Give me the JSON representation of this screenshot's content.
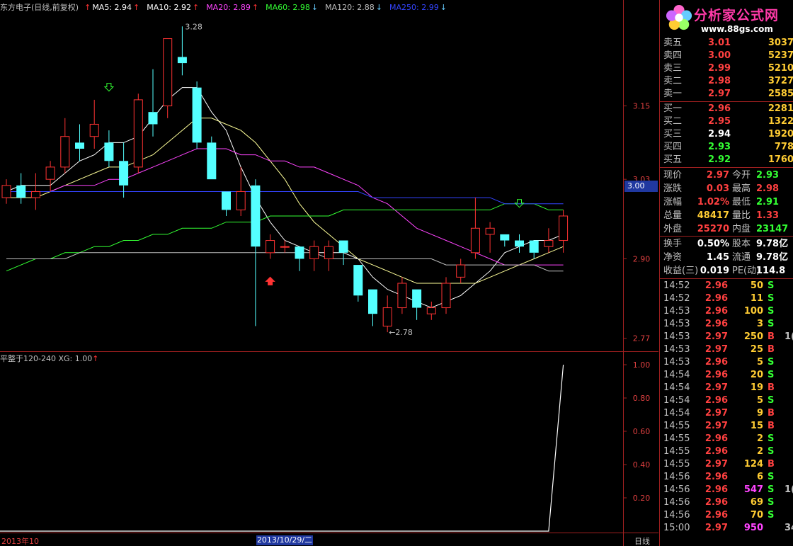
{
  "header": {
    "stock_title": "东方电子(日线,前复权)",
    "ma": [
      {
        "label": "MA5: 2.94",
        "color": "#ffffff",
        "arrow": "↑",
        "dir": "up"
      },
      {
        "label": "MA10: 2.92",
        "color": "#ffffff",
        "arrow": "↑",
        "dir": "up"
      },
      {
        "label": "MA20: 2.89",
        "color": "#ff44ff",
        "arrow": "↑",
        "dir": "up"
      },
      {
        "label": "MA60: 2.98",
        "color": "#33ff33",
        "arrow": "↓",
        "dir": "down"
      },
      {
        "label": "MA120: 2.88",
        "color": "#c0c0c0",
        "arrow": "↓",
        "dir": "down"
      },
      {
        "label": "MA250: 2.99",
        "color": "#3344ff",
        "arrow": "↓",
        "dir": "down"
      }
    ],
    "lead_arrow": "↑"
  },
  "price_axis": [
    "3.15",
    "3.03",
    "2.90",
    "2.77"
  ],
  "price_cursor": "3.00",
  "high_marker": "3.28",
  "low_marker": "←2.78",
  "indicator": {
    "legend": "平整于120-240  XG: 1.00",
    "arrow": "↑",
    "axis": [
      "1.00",
      "0.80",
      "0.60",
      "0.40",
      "0.20"
    ]
  },
  "x_axis": {
    "start": "2013年10",
    "cursor": "2013/10/29/二",
    "period": "日线"
  },
  "logo": {
    "brand": "分析家公式网",
    "url": "www.88gs.com"
  },
  "order_book": {
    "asks": [
      {
        "label": "卖五",
        "price": "3.01",
        "vol": "3037"
      },
      {
        "label": "卖四",
        "price": "3.00",
        "vol": "5237"
      },
      {
        "label": "卖三",
        "price": "2.99",
        "vol": "5210"
      },
      {
        "label": "卖二",
        "price": "2.98",
        "vol": "3727"
      },
      {
        "label": "卖一",
        "price": "2.97",
        "vol": "2585"
      }
    ],
    "bids": [
      {
        "label": "买一",
        "price": "2.96",
        "vol": "2281",
        "cls": "red"
      },
      {
        "label": "买二",
        "price": "2.95",
        "vol": "1322",
        "cls": "red"
      },
      {
        "label": "买三",
        "price": "2.94",
        "vol": "1920",
        "cls": "white"
      },
      {
        "label": "买四",
        "price": "2.93",
        "vol": "778",
        "cls": "green"
      },
      {
        "label": "买五",
        "price": "2.92",
        "vol": "1760",
        "cls": "green"
      }
    ]
  },
  "stats": [
    {
      "k1": "现价",
      "v1": "2.97",
      "c1": "red",
      "k2": "今开",
      "v2": "2.93",
      "c2": "green"
    },
    {
      "k1": "涨跌",
      "v1": "0.03",
      "c1": "red",
      "k2": "最高",
      "v2": "2.98",
      "c2": "red"
    },
    {
      "k1": "涨幅",
      "v1": "1.02%",
      "c1": "red",
      "k2": "最低",
      "v2": "2.91",
      "c2": "green"
    },
    {
      "k1": "总量",
      "v1": "48417",
      "c1": "yellow",
      "k2": "量比",
      "v2": "1.33",
      "c2": "red"
    },
    {
      "k1": "外盘",
      "v1": "25270",
      "c1": "red",
      "k2": "内盘",
      "v2": "23147",
      "c2": "green"
    },
    {
      "k1": "换手",
      "v1": "0.50%",
      "c1": "white",
      "k2": "股本",
      "v2": "9.78亿",
      "c2": "white"
    },
    {
      "k1": "净资",
      "v1": "1.45",
      "c1": "white",
      "k2": "流通",
      "v2": "9.78亿",
      "c2": "white"
    },
    {
      "k1": "收益(三)",
      "v1": "0.019",
      "c1": "white",
      "k2": "PE(动)",
      "v2": "114.8",
      "c2": "white"
    }
  ],
  "ticks": [
    {
      "time": "14:52",
      "price": "2.96",
      "vol": "50",
      "side": "S"
    },
    {
      "time": "14:52",
      "price": "2.96",
      "vol": "11",
      "side": "S"
    },
    {
      "time": "14:53",
      "price": "2.96",
      "vol": "100",
      "side": "S"
    },
    {
      "time": "14:53",
      "price": "2.96",
      "vol": "3",
      "side": "S"
    },
    {
      "time": "14:53",
      "price": "2.97",
      "vol": "250",
      "side": "B",
      "extra": "1("
    },
    {
      "time": "14:53",
      "price": "2.97",
      "vol": "25",
      "side": "B"
    },
    {
      "time": "14:53",
      "price": "2.96",
      "vol": "5",
      "side": "S"
    },
    {
      "time": "14:54",
      "price": "2.96",
      "vol": "20",
      "side": "S"
    },
    {
      "time": "14:54",
      "price": "2.97",
      "vol": "19",
      "side": "B"
    },
    {
      "time": "14:54",
      "price": "2.96",
      "vol": "5",
      "side": "S"
    },
    {
      "time": "14:54",
      "price": "2.97",
      "vol": "9",
      "side": "B"
    },
    {
      "time": "14:55",
      "price": "2.97",
      "vol": "15",
      "side": "B"
    },
    {
      "time": "14:55",
      "price": "2.96",
      "vol": "2",
      "side": "S"
    },
    {
      "time": "14:55",
      "price": "2.96",
      "vol": "2",
      "side": "S"
    },
    {
      "time": "14:55",
      "price": "2.97",
      "vol": "124",
      "side": "B"
    },
    {
      "time": "14:56",
      "price": "2.96",
      "vol": "6",
      "side": "S"
    },
    {
      "time": "14:56",
      "price": "2.96",
      "vol": "547",
      "side": "S",
      "vol_cls": "magenta",
      "extra": "1("
    },
    {
      "time": "14:56",
      "price": "2.96",
      "vol": "69",
      "side": "S"
    },
    {
      "time": "14:56",
      "price": "2.96",
      "vol": "70",
      "side": "S"
    },
    {
      "time": "15:00",
      "price": "2.97",
      "vol": "950",
      "side": "",
      "vol_cls": "magenta",
      "extra": "34"
    }
  ],
  "colors": {
    "up": "#ff3333",
    "down": "#54ffff",
    "ma5": "#ffffff",
    "ma10": "#ffff99",
    "ma20": "#ff44ff",
    "ma60": "#33ff33",
    "ma120": "#c0c0c0",
    "ma250": "#3344ff",
    "grid": "#a02020"
  },
  "candles": [
    {
      "o": 3.0,
      "c": 3.02,
      "h": 3.03,
      "l": 2.99,
      "up": true
    },
    {
      "o": 3.02,
      "c": 3.0,
      "h": 3.04,
      "l": 2.99,
      "up": false
    },
    {
      "o": 3.0,
      "c": 3.01,
      "h": 3.04,
      "l": 2.98,
      "up": true
    },
    {
      "o": 3.03,
      "c": 3.05,
      "h": 3.06,
      "l": 3.01,
      "up": true
    },
    {
      "o": 3.05,
      "c": 3.1,
      "h": 3.13,
      "l": 3.04,
      "up": true
    },
    {
      "o": 3.09,
      "c": 3.08,
      "h": 3.12,
      "l": 3.06,
      "up": false
    },
    {
      "o": 3.1,
      "c": 3.12,
      "h": 3.16,
      "l": 3.08,
      "up": true
    },
    {
      "o": 3.09,
      "c": 3.06,
      "h": 3.11,
      "l": 3.05,
      "up": false
    },
    {
      "o": 3.06,
      "c": 3.02,
      "h": 3.09,
      "l": 3.0,
      "up": false
    },
    {
      "o": 3.05,
      "c": 3.16,
      "h": 3.17,
      "l": 3.04,
      "up": true
    },
    {
      "o": 3.14,
      "c": 3.12,
      "h": 3.21,
      "l": 3.1,
      "up": false
    },
    {
      "o": 3.15,
      "c": 3.26,
      "h": 3.26,
      "l": 3.13,
      "up": true
    },
    {
      "o": 3.23,
      "c": 3.22,
      "h": 3.28,
      "l": 3.2,
      "up": false
    },
    {
      "o": 3.18,
      "c": 3.09,
      "h": 3.19,
      "l": 3.08,
      "up": false
    },
    {
      "o": 3.09,
      "c": 3.03,
      "h": 3.1,
      "l": 3.03,
      "up": false
    },
    {
      "o": 3.01,
      "c": 2.98,
      "h": 3.01,
      "l": 2.97,
      "up": false
    },
    {
      "o": 2.98,
      "c": 3.01,
      "h": 3.05,
      "l": 2.97,
      "up": true
    },
    {
      "o": 3.02,
      "c": 2.92,
      "h": 3.03,
      "l": 2.79,
      "up": false
    },
    {
      "o": 2.91,
      "c": 2.93,
      "h": 2.94,
      "l": 2.9,
      "up": true
    },
    {
      "o": 2.92,
      "c": 2.92,
      "h": 2.93,
      "l": 2.91,
      "up": true
    },
    {
      "o": 2.92,
      "c": 2.9,
      "h": 2.92,
      "l": 2.88,
      "up": false
    },
    {
      "o": 2.9,
      "c": 2.92,
      "h": 2.93,
      "l": 2.88,
      "up": true
    },
    {
      "o": 2.9,
      "c": 2.92,
      "h": 2.93,
      "l": 2.88,
      "up": true
    },
    {
      "o": 2.93,
      "c": 2.91,
      "h": 2.93,
      "l": 2.89,
      "up": false
    },
    {
      "o": 2.89,
      "c": 2.84,
      "h": 2.89,
      "l": 2.83,
      "up": false
    },
    {
      "o": 2.85,
      "c": 2.81,
      "h": 2.85,
      "l": 2.79,
      "up": false
    },
    {
      "o": 2.79,
      "c": 2.82,
      "h": 2.84,
      "l": 2.78,
      "up": true
    },
    {
      "o": 2.82,
      "c": 2.86,
      "h": 2.87,
      "l": 2.81,
      "up": true
    },
    {
      "o": 2.85,
      "c": 2.82,
      "h": 2.85,
      "l": 2.8,
      "up": false
    },
    {
      "o": 2.81,
      "c": 2.82,
      "h": 2.83,
      "l": 2.8,
      "up": true
    },
    {
      "o": 2.82,
      "c": 2.86,
      "h": 2.87,
      "l": 2.81,
      "up": true
    },
    {
      "o": 2.87,
      "c": 2.89,
      "h": 2.9,
      "l": 2.86,
      "up": true
    },
    {
      "o": 2.91,
      "c": 2.95,
      "h": 3.0,
      "l": 2.9,
      "up": true
    },
    {
      "o": 2.95,
      "c": 2.94,
      "h": 2.96,
      "l": 2.91,
      "up": true
    },
    {
      "o": 2.94,
      "c": 2.93,
      "h": 2.94,
      "l": 2.92,
      "up": false
    },
    {
      "o": 2.93,
      "c": 2.92,
      "h": 2.94,
      "l": 2.91,
      "up": false
    },
    {
      "o": 2.93,
      "c": 2.91,
      "h": 2.93,
      "l": 2.9,
      "up": false
    },
    {
      "o": 2.92,
      "c": 2.93,
      "h": 2.95,
      "l": 2.91,
      "up": true
    },
    {
      "o": 2.93,
      "c": 2.97,
      "h": 2.98,
      "l": 2.91,
      "up": true
    }
  ],
  "ma_lines": {
    "ma5": [
      3.01,
      3.02,
      3.02,
      3.02,
      3.04,
      3.06,
      3.07,
      3.09,
      3.09,
      3.1,
      3.13,
      3.16,
      3.18,
      3.18,
      3.14,
      3.11,
      3.05,
      3.0,
      2.96,
      2.93,
      2.92,
      2.91,
      2.91,
      2.91,
      2.9,
      2.87,
      2.85,
      2.84,
      2.83,
      2.82,
      2.83,
      2.84,
      2.86,
      2.88,
      2.91,
      2.92,
      2.93,
      2.93,
      2.94
    ],
    "ma10": [
      3.0,
      3.0,
      3.0,
      3.01,
      3.02,
      3.03,
      3.04,
      3.05,
      3.05,
      3.06,
      3.07,
      3.09,
      3.11,
      3.13,
      3.13,
      3.12,
      3.11,
      3.09,
      3.06,
      3.03,
      2.99,
      2.96,
      2.94,
      2.92,
      2.9,
      2.89,
      2.88,
      2.87,
      2.86,
      2.86,
      2.86,
      2.86,
      2.86,
      2.87,
      2.88,
      2.89,
      2.9,
      2.91,
      2.92
    ],
    "ma20": [
      3.01,
      3.01,
      3.01,
      3.01,
      3.02,
      3.02,
      3.02,
      3.03,
      3.03,
      3.04,
      3.05,
      3.06,
      3.07,
      3.08,
      3.08,
      3.08,
      3.07,
      3.07,
      3.06,
      3.06,
      3.05,
      3.05,
      3.04,
      3.03,
      3.02,
      3.0,
      2.99,
      2.97,
      2.95,
      2.94,
      2.93,
      2.92,
      2.91,
      2.9,
      2.89,
      2.89,
      2.89,
      2.89,
      2.89
    ],
    "ma60": [
      2.88,
      2.89,
      2.9,
      2.9,
      2.91,
      2.91,
      2.92,
      2.92,
      2.93,
      2.93,
      2.94,
      2.94,
      2.95,
      2.95,
      2.95,
      2.96,
      2.96,
      2.96,
      2.97,
      2.97,
      2.97,
      2.97,
      2.97,
      2.98,
      2.98,
      2.98,
      2.98,
      2.98,
      2.98,
      2.98,
      2.98,
      2.98,
      2.98,
      2.98,
      2.99,
      2.99,
      2.99,
      2.98,
      2.98
    ],
    "ma120": [
      2.9,
      2.9,
      2.9,
      2.9,
      2.9,
      2.91,
      2.91,
      2.91,
      2.91,
      2.91,
      2.91,
      2.91,
      2.91,
      2.91,
      2.91,
      2.91,
      2.91,
      2.91,
      2.91,
      2.91,
      2.91,
      2.91,
      2.9,
      2.9,
      2.9,
      2.9,
      2.9,
      2.9,
      2.9,
      2.9,
      2.89,
      2.89,
      2.89,
      2.89,
      2.89,
      2.89,
      2.89,
      2.88,
      2.88
    ],
    "ma250": [
      3.01,
      3.01,
      3.01,
      3.01,
      3.01,
      3.01,
      3.01,
      3.01,
      3.01,
      3.01,
      3.01,
      3.01,
      3.01,
      3.01,
      3.01,
      3.01,
      3.01,
      3.01,
      3.01,
      3.01,
      3.01,
      3.01,
      3.01,
      3.01,
      3.01,
      3.0,
      3.0,
      3.0,
      3.0,
      3.0,
      3.0,
      3.0,
      3.0,
      3.0,
      2.99,
      2.99,
      2.99,
      2.99,
      2.99
    ]
  },
  "indicator_series": [
    0,
    0,
    0,
    0,
    0,
    0,
    0,
    0,
    0,
    0,
    0,
    0,
    0,
    0,
    0,
    0,
    0,
    0,
    0,
    0,
    0,
    0,
    0,
    0,
    0,
    0,
    0,
    0,
    0,
    0,
    0,
    0,
    0,
    0,
    0,
    0,
    0,
    0,
    1
  ]
}
